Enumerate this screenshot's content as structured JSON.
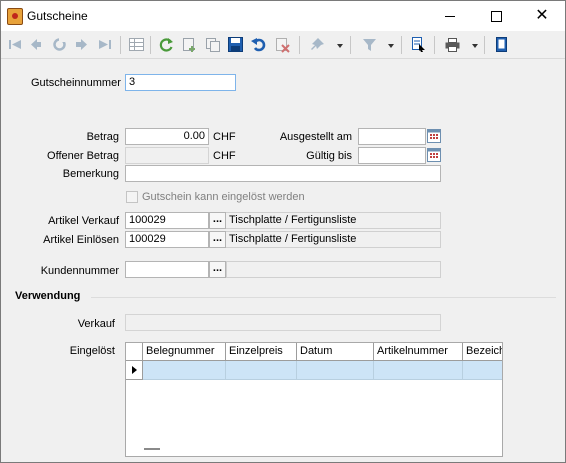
{
  "window": {
    "title": "Gutscheine",
    "close_glyph": "✕"
  },
  "toolbar": {
    "icons": [
      "first-record-icon",
      "previous-record-icon",
      "refresh-disabled-icon",
      "next-record-icon",
      "last-record-icon",
      "table-view-icon",
      "refresh-icon",
      "new-record-icon",
      "copy-record-icon",
      "save-icon",
      "undo-icon",
      "delete-icon",
      "pin-icon",
      "filter-icon",
      "search-document-icon",
      "print-icon",
      "notes-icon"
    ]
  },
  "form": {
    "voucher_number_label": "Gutscheinnummer",
    "voucher_number_value": "3",
    "amount_label": "Betrag",
    "amount_value": "0.00",
    "amount_currency": "CHF",
    "open_amount_label": "Offener Betrag",
    "open_amount_currency": "CHF",
    "issued_label": "Ausgestellt am",
    "valid_until_label": "Gültig bis",
    "remark_label": "Bemerkung",
    "redeemable_label": "Gutschein kann eingelöst werden",
    "article_sale_label": "Artikel Verkauf",
    "article_sale_value": "100029",
    "article_sale_desc": "Tischplatte / Fertigunsliste",
    "article_redeem_label": "Artikel Einlösen",
    "article_redeem_value": "100029",
    "article_redeem_desc": "Tischplatte / Fertigunsliste",
    "customer_number_label": "Kundennummer",
    "ellipsis": "..."
  },
  "usage": {
    "section_title": "Verwendung",
    "sale_label": "Verkauf",
    "redeemed_label": "Eingelöst",
    "columns": [
      "Belegnummer",
      "Einzelpreis",
      "Datum",
      "Artikelnummer",
      "Bezeich"
    ]
  },
  "colors": {
    "accent": "#0b5aa8",
    "selection": "#cde4f7"
  }
}
